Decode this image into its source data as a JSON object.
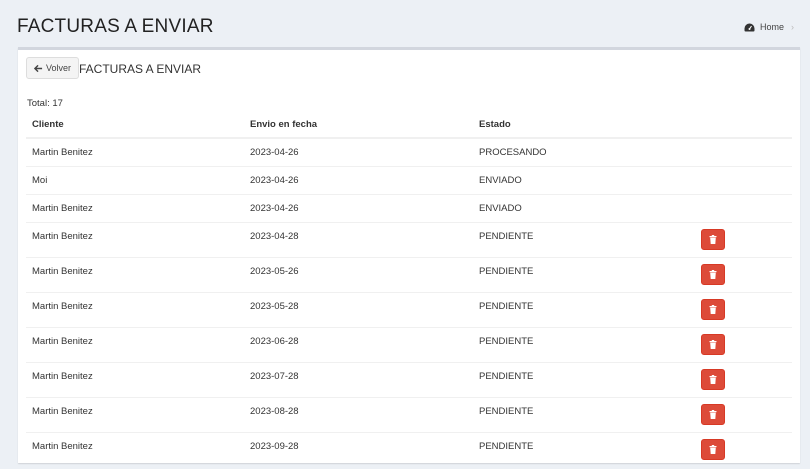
{
  "header": {
    "title": "FACTURAS A ENVIAR",
    "breadcrumb": "Home"
  },
  "box": {
    "back_label": "Volver",
    "title": "FACTURAS A ENVIAR",
    "total": "Total: 17"
  },
  "table": {
    "columns": [
      "Cliente",
      "Envio en fecha",
      "Estado"
    ],
    "rows": [
      {
        "cliente": "Martin Benitez",
        "fecha": "2023-04-26",
        "estado": "PROCESANDO",
        "delete": false
      },
      {
        "cliente": "Moi",
        "fecha": "2023-04-26",
        "estado": "ENVIADO",
        "delete": false
      },
      {
        "cliente": "Martin Benitez",
        "fecha": "2023-04-26",
        "estado": "ENVIADO",
        "delete": false
      },
      {
        "cliente": "Martin Benitez",
        "fecha": "2023-04-28",
        "estado": "PENDIENTE",
        "delete": true
      },
      {
        "cliente": "Martin Benitez",
        "fecha": "2023-05-26",
        "estado": "PENDIENTE",
        "delete": true
      },
      {
        "cliente": "Martin Benitez",
        "fecha": "2023-05-28",
        "estado": "PENDIENTE",
        "delete": true
      },
      {
        "cliente": "Martin Benitez",
        "fecha": "2023-06-28",
        "estado": "PENDIENTE",
        "delete": true
      },
      {
        "cliente": "Martin Benitez",
        "fecha": "2023-07-28",
        "estado": "PENDIENTE",
        "delete": true
      },
      {
        "cliente": "Martin Benitez",
        "fecha": "2023-08-28",
        "estado": "PENDIENTE",
        "delete": true
      },
      {
        "cliente": "Martin Benitez",
        "fecha": "2023-09-28",
        "estado": "PENDIENTE",
        "delete": true
      }
    ]
  },
  "icons": {
    "breadcrumb": "dashboard-icon",
    "back": "arrow-left-icon",
    "delete": "trash-icon"
  },
  "colors": {
    "background": "#ecf0f5",
    "delete_button": "#dd4b39"
  }
}
